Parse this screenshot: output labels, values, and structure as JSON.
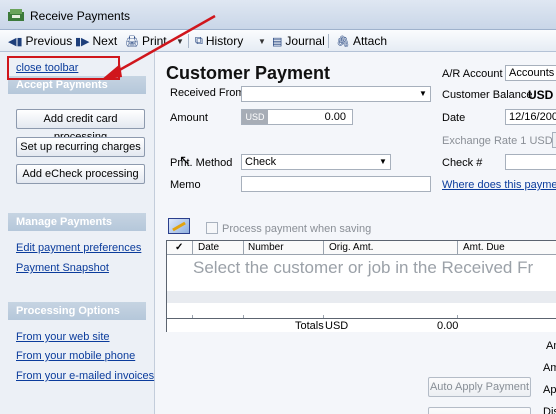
{
  "window": {
    "title": "Receive Payments"
  },
  "toolbar": {
    "previous": "Previous",
    "next": "Next",
    "print": "Print",
    "history": "History",
    "journal": "Journal",
    "attach": "Attach"
  },
  "sidebar": {
    "close_toolbar": "close toolbar",
    "accept_header": "Accept Payments",
    "buttons": [
      "Add credit card processing",
      "Set up recurring charges",
      "Add eCheck processing"
    ],
    "manage_header": "Manage Payments",
    "manage_links": [
      "Edit payment preferences",
      "Payment Snapshot"
    ],
    "processing_header": "Processing Options",
    "processing_links": [
      "From your web site",
      "From your mobile phone",
      "From your e-mailed invoices"
    ]
  },
  "form": {
    "title": "Customer Payment",
    "received_from_label": "Received From",
    "received_from_value": "",
    "amount_label": "Amount",
    "amount_currency": "USD",
    "amount_value": "0.00",
    "pmt_method_label": "Pmt. Method",
    "pmt_method_value": "Check",
    "memo_label": "Memo",
    "memo_value": "",
    "ar_account_label": "A/R Account",
    "ar_account_value": "Accounts R",
    "customer_balance_label": "Customer Balance",
    "customer_balance_currency": "USD",
    "date_label": "Date",
    "date_value": "12/16/2009",
    "exchange_rate_label": "Exchange Rate 1 USD =",
    "check_no_label": "Check #",
    "check_no_value": "",
    "where_link": "Where does this payment g"
  },
  "process": {
    "label": "Process  payment when saving",
    "checked": false
  },
  "grid": {
    "columns": [
      "✓",
      "Date",
      "Number",
      "Orig. Amt.",
      "Amt. Due"
    ],
    "hint": "Select the customer or job in the Received Fr",
    "totals_label": "Totals",
    "totals_currency": "USD",
    "totals_amount": "0.00"
  },
  "right_panel": {
    "labels": [
      "Am",
      "Am",
      "App",
      "Dis"
    ]
  },
  "buttons": {
    "auto_apply": "Auto Apply Payment"
  },
  "colors": {
    "highlight_red": "#d0161c",
    "link_blue": "#0b3c9c",
    "section_header": "#b5c7da"
  }
}
